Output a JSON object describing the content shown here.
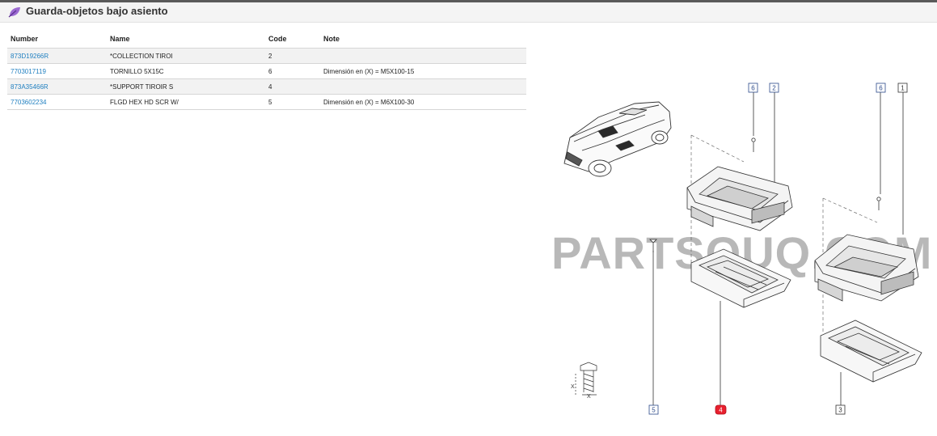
{
  "header": {
    "title": "Guarda-objetos bajo asiento",
    "icon": "leaf-icon",
    "accent": "#8a4fc4"
  },
  "table": {
    "columns": [
      "Number",
      "Name",
      "Code",
      "Note"
    ],
    "rows": [
      {
        "number": "873D19266R",
        "name": "*COLLECTION TIROI",
        "code": "2",
        "note": ""
      },
      {
        "number": "7703017119",
        "name": "TORNILLO 5X15C",
        "code": "6",
        "note": "Dimensión en (X) = M5X100-15"
      },
      {
        "number": "873A35466R",
        "name": "*SUPPORT TIROIR S",
        "code": "4",
        "note": ""
      },
      {
        "number": "7703602234",
        "name": "FLGD HEX HD SCR W/",
        "code": "5",
        "note": "Dimensión en (X) = M6X100-30"
      }
    ]
  },
  "diagram": {
    "watermark": "PARTSOUQ.COM",
    "callouts": {
      "c6a": "6",
      "c2": "2",
      "c6b": "6",
      "c1": "1",
      "c5": "5",
      "c4": "4",
      "c3": "3"
    },
    "screw_labels": {
      "x1": "X",
      "x2": "X"
    },
    "highlight_color": "#e8202e"
  }
}
